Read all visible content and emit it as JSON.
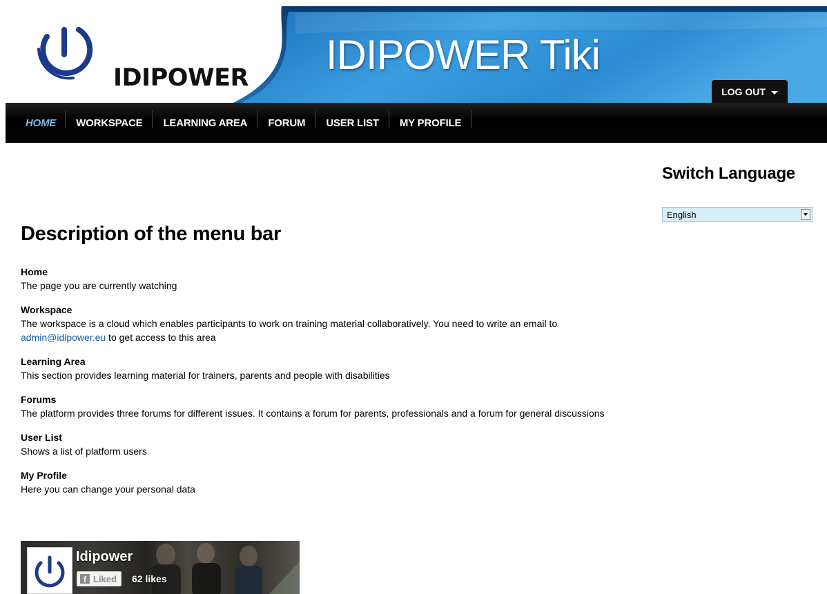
{
  "header": {
    "logo_text": "IDIPOWER",
    "site_title": "IDIPOWER Tiki",
    "logout_label": "LOG OUT"
  },
  "nav": {
    "items": [
      {
        "label": "HOME",
        "active": true
      },
      {
        "label": "WORKSPACE"
      },
      {
        "label": "LEARNING AREA"
      },
      {
        "label": "FORUM"
      },
      {
        "label": "USER LIST"
      },
      {
        "label": "MY PROFILE"
      }
    ]
  },
  "sidebar": {
    "switch_language_title": "Switch Language",
    "language_selected": "English"
  },
  "main": {
    "title": "Description of the menu bar",
    "items": [
      {
        "term": "Home",
        "text": "The page you are currently watching"
      },
      {
        "term": "Workspace",
        "text": "The workspace is a cloud which enables participants to work on training material collaboratively. You need to write an email to",
        "link": "admin@idipower.eu",
        "text_after": " to get access to this area"
      },
      {
        "term": "Learning Area",
        "text": "This section provides learning material for trainers, parents and people with disabilities"
      },
      {
        "term": "Forums",
        "text": "The platform provides three forums for different issues. It contains a forum for parents, professionals and a forum for general discussions"
      },
      {
        "term": "User List",
        "text": "Shows a list of platform users"
      },
      {
        "term": "My Profile",
        "text": "Here you can change your personal data"
      }
    ]
  },
  "facebook": {
    "page_name": "Idipower",
    "liked_label": "Liked",
    "likes_count": "62 likes"
  },
  "colors": {
    "banner_blue": "#2a8fd4",
    "nav_black": "#000000",
    "nav_active": "#7fb8e6",
    "link": "#1a5fa8",
    "logo_blue": "#1a3a8c"
  }
}
